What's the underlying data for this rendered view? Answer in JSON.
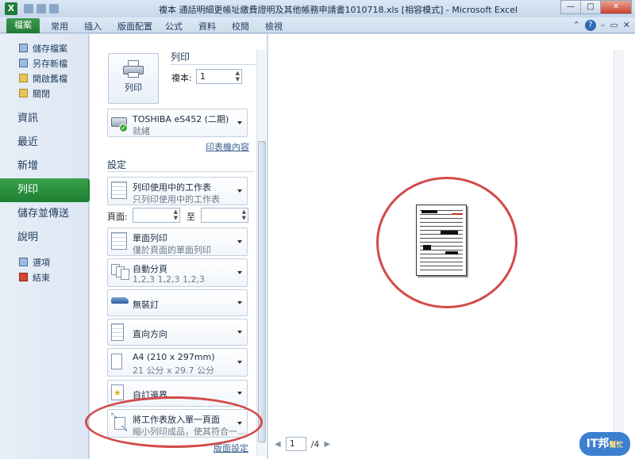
{
  "window": {
    "title": "複本 通話明細更帳址繳費證明及其他帳務申請書1010718.xls  [相容模式]  -  Microsoft Excel",
    "minimize": "—",
    "maximize": "□",
    "close": "✕"
  },
  "tabs": [
    "檔案",
    "常用",
    "插入",
    "版面配置",
    "公式",
    "資料",
    "校閱",
    "檢視"
  ],
  "nav": {
    "small_top": [
      "儲存檔案",
      "另存新檔",
      "開啟舊檔",
      "關閉"
    ],
    "big": [
      "資訊",
      "最近",
      "新增",
      "列印",
      "儲存並傳送",
      "說明"
    ],
    "small_bottom": [
      "選項",
      "結束"
    ],
    "active": "列印"
  },
  "print": {
    "button_label": "列印",
    "section_title": "列印",
    "copies_label": "複本:",
    "copies_value": "1",
    "printer_name": "TOSHIBA eS452 (二期)",
    "printer_status": "就緒",
    "printer_props_link": "印表機內容",
    "settings_title": "設定",
    "settings": [
      {
        "key": "what",
        "t1": "列印使用中的工作表",
        "t2": "只列印使用中的工作表"
      },
      {
        "key": "sides",
        "t1": "單面列印",
        "t2": "僅於頁面的單面列印"
      },
      {
        "key": "collate",
        "t1": "自動分頁",
        "t2": "1,2,3    1,2,3    1,2,3"
      },
      {
        "key": "staple",
        "t1": "無裝訂",
        "t2": ""
      },
      {
        "key": "orient",
        "t1": "直向方向",
        "t2": ""
      },
      {
        "key": "paper",
        "t1": "A4 (210 x 297mm)",
        "t2": "21 公分 x 29.7 公分"
      },
      {
        "key": "margins",
        "t1": "自訂邊界",
        "t2": ""
      },
      {
        "key": "scaling",
        "t1": "將工作表放入單一頁面",
        "t2": "縮小列印成品，使其符合一..."
      }
    ],
    "pages_label": "頁面:",
    "pages_to": "至",
    "page_setup_link": "版面設定"
  },
  "preview": {
    "current_page": "1",
    "total_pages": "/4"
  },
  "badge": {
    "main": "IT邦",
    "sub": "幫忙"
  },
  "colors": {
    "file_tab": "#1f7a34",
    "highlight_circle": "#d24a4a"
  }
}
